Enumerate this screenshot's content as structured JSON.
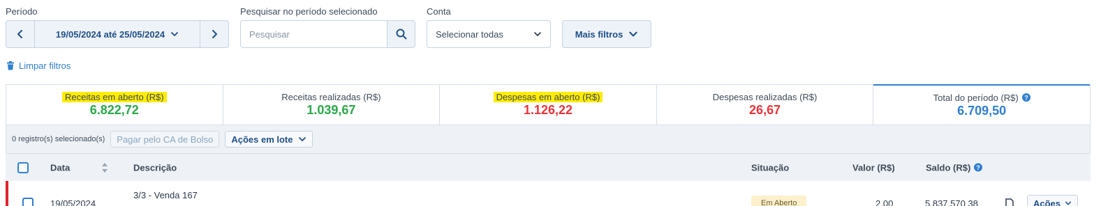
{
  "filters": {
    "period_label": "Período",
    "period_value": "19/05/2024 até 25/05/2024",
    "search_label": "Pesquisar no período selecionado",
    "search_placeholder": "Pesquisar",
    "search_value": "",
    "account_label": "Conta",
    "account_value": "Selecionar todas",
    "more_filters": "Mais filtros",
    "clear_filters": "Limpar filtros"
  },
  "summary": [
    {
      "label": "Receitas em aberto (R$)",
      "value": "6.822,72",
      "color": "#2aa84a",
      "highlighted": true
    },
    {
      "label": "Receitas realizadas (R$)",
      "value": "1.039,67",
      "color": "#2aa84a",
      "highlighted": false
    },
    {
      "label": "Despesas em aberto (R$)",
      "value": "1.126,22",
      "color": "#e8353b",
      "highlighted": true
    },
    {
      "label": "Despesas realizadas (R$)",
      "value": "26,67",
      "color": "#e8353b",
      "highlighted": false
    },
    {
      "label": "Total do período (R$)",
      "value": "6.709,50",
      "color": "#2f7fcf",
      "highlighted": false
    }
  ],
  "actionbar": {
    "selected_count": "0 registro(s) selecionado(s)",
    "pay_button": "Pagar pelo CA de Bolso",
    "batch_actions": "Ações em lote"
  },
  "table": {
    "columns": {
      "date": "Data",
      "description": "Descrição",
      "status": "Situação",
      "value": "Valor (R$)",
      "balance": "Saldo (R$)"
    },
    "rows": [
      {
        "date": "19/05/2024",
        "description": "3/3 - Venda 167",
        "status": "Em Aberto",
        "value": "2,00",
        "balance": "5.837.570,38",
        "actions": "Ações"
      }
    ]
  },
  "colors": {
    "accent": "#2f7fcf",
    "income": "#2aa84a",
    "expense": "#e8353b",
    "highlight": "#ffec00"
  }
}
